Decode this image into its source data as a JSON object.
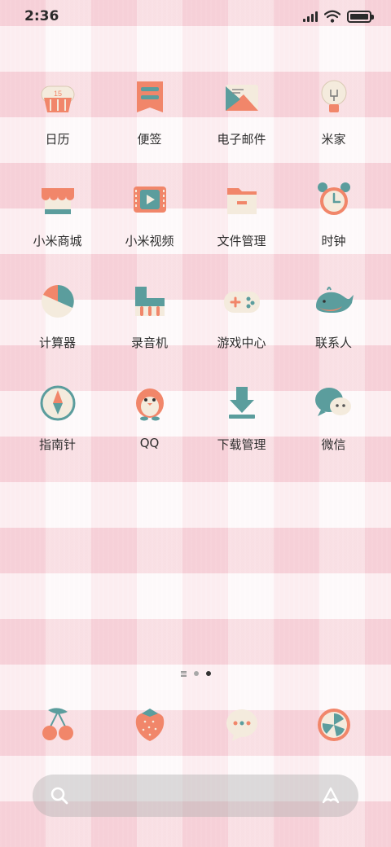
{
  "status_bar": {
    "time": "2:36",
    "signal_icon": "signal-icon",
    "wifi_icon": "wifi-icon",
    "battery_icon": "battery-icon"
  },
  "apps": [
    {
      "label": "日历",
      "icon": "calendar-icon",
      "badge_text": "15"
    },
    {
      "label": "便签",
      "icon": "notes-icon"
    },
    {
      "label": "电子邮件",
      "icon": "email-icon"
    },
    {
      "label": "米家",
      "icon": "lightbulb-icon"
    },
    {
      "label": "小米商城",
      "icon": "store-icon"
    },
    {
      "label": "小米视频",
      "icon": "video-icon"
    },
    {
      "label": "文件管理",
      "icon": "folder-icon"
    },
    {
      "label": "时钟",
      "icon": "alarm-clock-icon"
    },
    {
      "label": "计算器",
      "icon": "calculator-icon"
    },
    {
      "label": "录音机",
      "icon": "recorder-icon"
    },
    {
      "label": "游戏中心",
      "icon": "gamepad-icon"
    },
    {
      "label": "联系人",
      "icon": "whale-icon"
    },
    {
      "label": "指南针",
      "icon": "compass-icon"
    },
    {
      "label": "QQ",
      "icon": "penguin-icon"
    },
    {
      "label": "下载管理",
      "icon": "download-icon"
    },
    {
      "label": "微信",
      "icon": "chat-bubbles-icon"
    }
  ],
  "page_indicator": {
    "pages": 2,
    "active_index": 1,
    "has_feed_lines": true
  },
  "dock": [
    {
      "icon": "cherries-icon"
    },
    {
      "icon": "strawberry-icon"
    },
    {
      "icon": "message-bubble-icon"
    },
    {
      "icon": "browser-icon"
    }
  ],
  "search_bar": {
    "search_icon": "search-icon",
    "assistant_icon": "assistant-icon"
  },
  "colors": {
    "coral": "#f1866a",
    "teal": "#5b9d9d",
    "cream": "#f4ebdd",
    "label": "#2e2e2e"
  }
}
